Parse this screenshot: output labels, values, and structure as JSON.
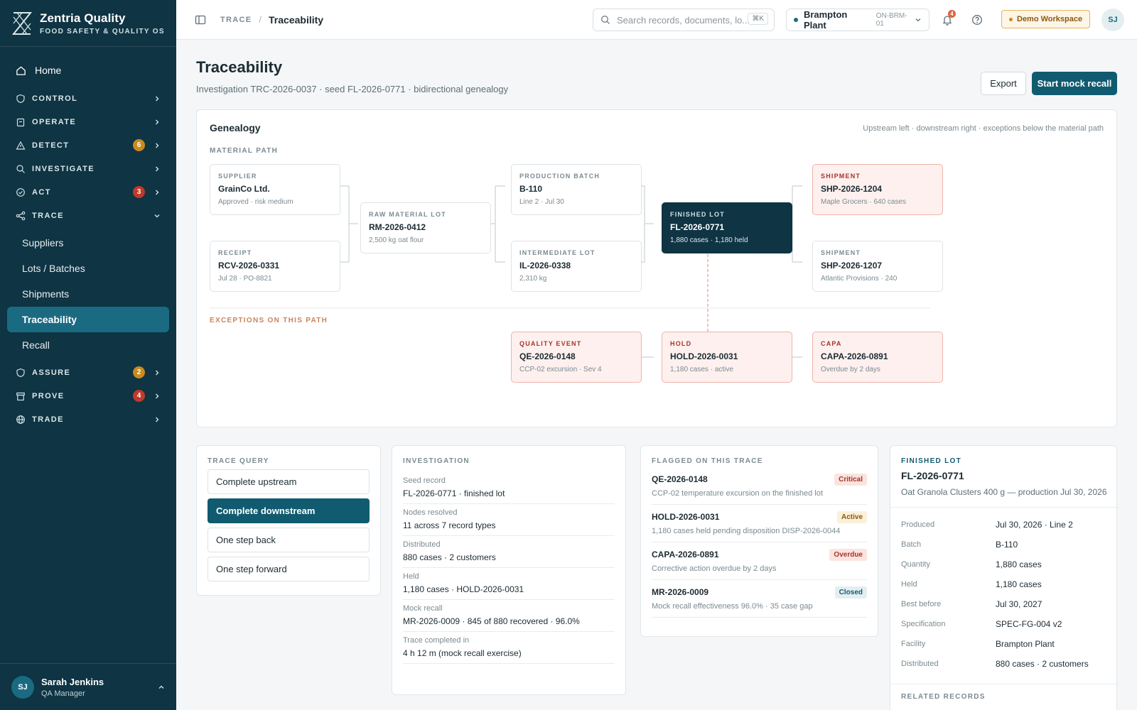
{
  "brand": {
    "name": "Zentria Quality",
    "subtitle": "FOOD SAFETY & QUALITY OS"
  },
  "nav": {
    "home": "Home",
    "sections": [
      {
        "label": "CONTROL",
        "icon": "shield-check-icon",
        "badge": null
      },
      {
        "label": "OPERATE",
        "icon": "clipboard-icon",
        "badge": null
      },
      {
        "label": "DETECT",
        "icon": "warning-icon",
        "badge": "6",
        "badge_color": "#c98a1e"
      },
      {
        "label": "INVESTIGATE",
        "icon": "search-icon",
        "badge": null
      },
      {
        "label": "ACT",
        "icon": "check-circle-icon",
        "badge": "3",
        "badge_color": "#c0392b"
      },
      {
        "label": "TRACE",
        "icon": "share-icon",
        "badge": null,
        "expanded": true
      }
    ],
    "trace_items": [
      "Suppliers",
      "Lots / Batches",
      "Shipments",
      "Traceability",
      "Recall"
    ],
    "active_item": "Traceability",
    "sections_after": [
      {
        "label": "ASSURE",
        "icon": "shield-icon",
        "badge": "2",
        "badge_color": "#c98a1e"
      },
      {
        "label": "PROVE",
        "icon": "archive-icon",
        "badge": "4",
        "badge_color": "#c0392b"
      },
      {
        "label": "TRADE",
        "icon": "globe-icon",
        "badge": null
      }
    ]
  },
  "user": {
    "initials": "SJ",
    "name": "Sarah Jenkins",
    "role": "QA Manager"
  },
  "topbar": {
    "crumb_section": "TRACE",
    "crumb_page": "Traceability",
    "search_placeholder": "Search records, documents, lo...",
    "search_shortcut": "⌘K",
    "plant_name": "Brampton Plant",
    "plant_code": "ON-BRM-01",
    "notif_count": "4",
    "workspace": "Demo Workspace",
    "initials": "SJ"
  },
  "page": {
    "title": "Traceability",
    "subtitle": "Investigation TRC-2026-0037 · seed FL-2026-0771 · bidirectional genealogy",
    "export_label": "Export",
    "primary_label": "Start mock recall"
  },
  "genealogy": {
    "title": "Genealogy",
    "hint": "Upstream left · downstream right · exceptions below the material path",
    "material_label": "MATERIAL PATH",
    "exceptions_label": "EXCEPTIONS ON THIS PATH",
    "nodes": {
      "supplier": {
        "kind": "SUPPLIER",
        "id": "GrainCo Ltd.",
        "detail": "Approved · risk medium"
      },
      "receipt": {
        "kind": "RECEIPT",
        "id": "RCV-2026-0331",
        "detail": "Jul 28 · PO-8821"
      },
      "raw": {
        "kind": "RAW MATERIAL LOT",
        "id": "RM-2026-0412",
        "detail": "2,500 kg oat flour"
      },
      "batch": {
        "kind": "PRODUCTION BATCH",
        "id": "B-110",
        "detail": "Line 2 · Jul 30"
      },
      "intermediate": {
        "kind": "INTERMEDIATE LOT",
        "id": "IL-2026-0338",
        "detail": "2,310 kg"
      },
      "finished": {
        "kind": "FINISHED LOT",
        "id": "FL-2026-0771",
        "detail": "1,880 cases · 1,180 held"
      },
      "ship1": {
        "kind": "SHIPMENT",
        "id": "SHP-2026-1204",
        "detail": "Maple Grocers · 640 cases"
      },
      "ship2": {
        "kind": "SHIPMENT",
        "id": "SHP-2026-1207",
        "detail": "Atlantic Provisions · 240"
      },
      "qe": {
        "kind": "QUALITY EVENT",
        "id": "QE-2026-0148",
        "detail": "CCP-02 excursion · Sev 4"
      },
      "hold": {
        "kind": "HOLD",
        "id": "HOLD-2026-0031",
        "detail": "1,180 cases · active"
      },
      "capa": {
        "kind": "CAPA",
        "id": "CAPA-2026-0891",
        "detail": "Overdue by 2 days"
      }
    }
  },
  "trace_query": {
    "title": "TRACE QUERY",
    "options": [
      "Complete upstream",
      "Complete downstream",
      "One step back",
      "One step forward"
    ],
    "active": "Complete downstream"
  },
  "investigation": {
    "title": "INVESTIGATION",
    "rows": [
      {
        "k": "Seed record",
        "v": "FL-2026-0771 · finished lot"
      },
      {
        "k": "Nodes resolved",
        "v": "11 across 7 record types"
      },
      {
        "k": "Distributed",
        "v": "880 cases · 2 customers"
      },
      {
        "k": "Held",
        "v": "1,180 cases · HOLD-2026-0031"
      },
      {
        "k": "Mock recall",
        "v": "MR-2026-0009 · 845 of 880 recovered · 96.0%"
      },
      {
        "k": "Trace completed in",
        "v": "4 h 12 m (mock recall exercise)"
      }
    ]
  },
  "flagged": {
    "title": "FLAGGED ON THIS TRACE",
    "items": [
      {
        "id": "QE-2026-0148",
        "desc": "CCP-02 temperature excursion on the finished lot",
        "tag": "Critical"
      },
      {
        "id": "HOLD-2026-0031",
        "desc": "1,180 cases held pending disposition DISP-2026-0044",
        "tag": "Active"
      },
      {
        "id": "CAPA-2026-0891",
        "desc": "Corrective action overdue by 2 days",
        "tag": "Overdue"
      },
      {
        "id": "MR-2026-0009",
        "desc": "Mock recall effectiveness 96.0% · 35 case gap",
        "tag": "Closed"
      }
    ]
  },
  "finished_lot": {
    "kicker": "FINISHED LOT",
    "id": "FL-2026-0771",
    "desc": "Oat Granola Clusters 400 g — production Jul 30, 2026",
    "rows": [
      {
        "k": "Produced",
        "v": "Jul 30, 2026 · Line 2"
      },
      {
        "k": "Batch",
        "v": "B-110"
      },
      {
        "k": "Quantity",
        "v": "1,880 cases"
      },
      {
        "k": "Held",
        "v": "1,180 cases"
      },
      {
        "k": "Best before",
        "v": "Jul 30, 2027"
      },
      {
        "k": "Specification",
        "v": "SPEC-FG-004 v2"
      },
      {
        "k": "Facility",
        "v": "Brampton Plant"
      },
      {
        "k": "Distributed",
        "v": "880 cases · 2 customers"
      }
    ],
    "related_label": "RELATED RECORDS"
  }
}
